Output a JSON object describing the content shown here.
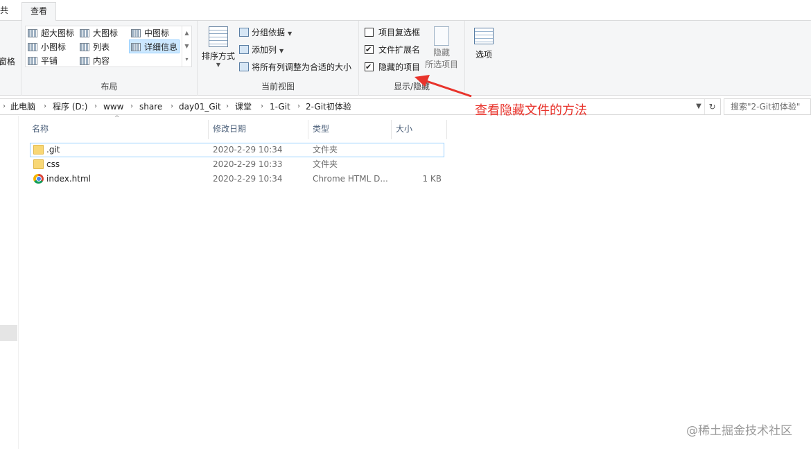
{
  "tabs": {
    "share": "共享",
    "view": "查看"
  },
  "ribbon": {
    "pane_label": "窗格",
    "layout": {
      "title": "布局",
      "items": [
        "超大图标",
        "大图标",
        "中图标",
        "小图标",
        "列表",
        "详细信息",
        "平铺",
        "内容"
      ],
      "selected": "详细信息"
    },
    "current_view": {
      "title": "当前视图",
      "sort_label": "排序方式",
      "group_by": "分组依据",
      "add_column": "添加列",
      "fit_columns": "将所有列调整为合适的大小"
    },
    "show_hide": {
      "title": "显示/隐藏",
      "item_checkboxes": {
        "label": "项目复选框",
        "checked": false
      },
      "file_extensions": {
        "label": "文件扩展名",
        "checked": true
      },
      "hidden_items": {
        "label": "隐藏的项目",
        "checked": true
      },
      "hide_selected_line1": "隐藏",
      "hide_selected_line2": "所选项目"
    },
    "options_label": "选项"
  },
  "address": {
    "crumbs": [
      "此电脑",
      "程序 (D:)",
      "www",
      "share",
      "day01_Git",
      "课堂",
      "1-Git",
      "2-Git初体验"
    ]
  },
  "search": {
    "placeholder": "搜索\"2-Git初体验\""
  },
  "columns": {
    "name": "名称",
    "date": "修改日期",
    "type": "类型",
    "size": "大小"
  },
  "files": [
    {
      "name": ".git",
      "date": "2020-2-29 10:34",
      "type": "文件夹",
      "size": "",
      "icon": "folder-icon"
    },
    {
      "name": "css",
      "date": "2020-2-29 10:33",
      "type": "文件夹",
      "size": "",
      "icon": "folder-icon"
    },
    {
      "name": "index.html",
      "date": "2020-2-29 10:34",
      "type": "Chrome HTML D...",
      "size": "1 KB",
      "icon": "chrome-icon"
    }
  ],
  "annotation": {
    "text": "查看隐藏文件的方法",
    "color": "#e8332b"
  },
  "watermark": "@稀土掘金技术社区"
}
